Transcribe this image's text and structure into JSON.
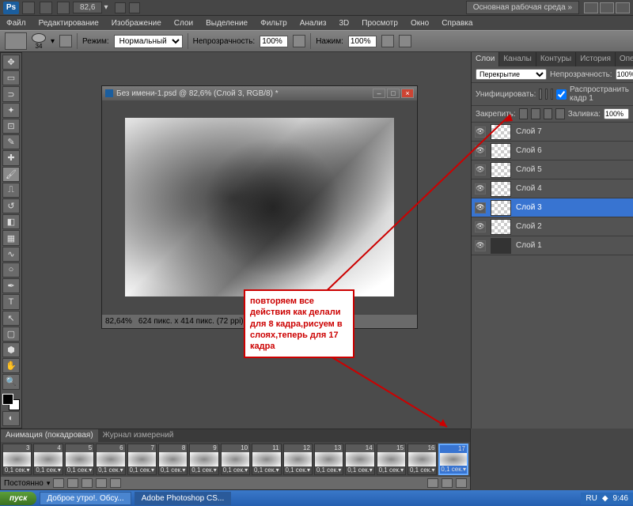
{
  "top": {
    "zoom": "82,6",
    "workspace": "Основная рабочая среда",
    "arrows": "»"
  },
  "menu": [
    "Файл",
    "Редактирование",
    "Изображение",
    "Слои",
    "Выделение",
    "Фильтр",
    "Анализ",
    "3D",
    "Просмотр",
    "Окно",
    "Справка"
  ],
  "opt": {
    "brush_size": "34",
    "mode_label": "Режим:",
    "mode_value": "Нормальный",
    "opacity_label": "Непрозрачность:",
    "opacity_value": "100%",
    "flow_label": "Нажим:",
    "flow_value": "100%"
  },
  "doc": {
    "title": "Без имени-1.psd @ 82,6% (Слой 3, RGB/8) *",
    "zoom": "82,64%",
    "status": "624 пикс. x 414 пикс. (72 ppi)"
  },
  "layers_panel": {
    "tabs": [
      "Слои",
      "Каналы",
      "Контуры",
      "История",
      "Операции"
    ],
    "blend": "Перекрытие",
    "opacity_label": "Непрозрачность:",
    "opacity": "100%",
    "unify_label": "Унифицировать:",
    "propagate": "Распространить кадр 1",
    "lock_label": "Закрепить:",
    "fill_label": "Заливка:",
    "fill": "100%",
    "layers": [
      {
        "name": "Слой 7",
        "sel": false
      },
      {
        "name": "Слой 6",
        "sel": false
      },
      {
        "name": "Слой 5",
        "sel": false
      },
      {
        "name": "Слой 4",
        "sel": false
      },
      {
        "name": "Слой 3",
        "sel": true
      },
      {
        "name": "Слой 2",
        "sel": false
      },
      {
        "name": "Слой 1",
        "sel": false
      }
    ]
  },
  "callout": "повторяем все действия как делали для 8 кадра,рисуем в слоях,теперь для 17 кадра",
  "anim": {
    "tabs": [
      "Анимация (покадровая)",
      "Журнал измерений"
    ],
    "frames": [
      3,
      4,
      5,
      6,
      7,
      8,
      9,
      10,
      11,
      12,
      13,
      14,
      15,
      16,
      17
    ],
    "selected": 17,
    "time": "0,1 сек.",
    "loop": "Постоянно"
  },
  "taskbar": {
    "start": "пуск",
    "tasks": [
      "Доброе утро!. Обсу...",
      "Adobe Photoshop CS..."
    ],
    "lang": "RU",
    "clock": "9:46"
  }
}
